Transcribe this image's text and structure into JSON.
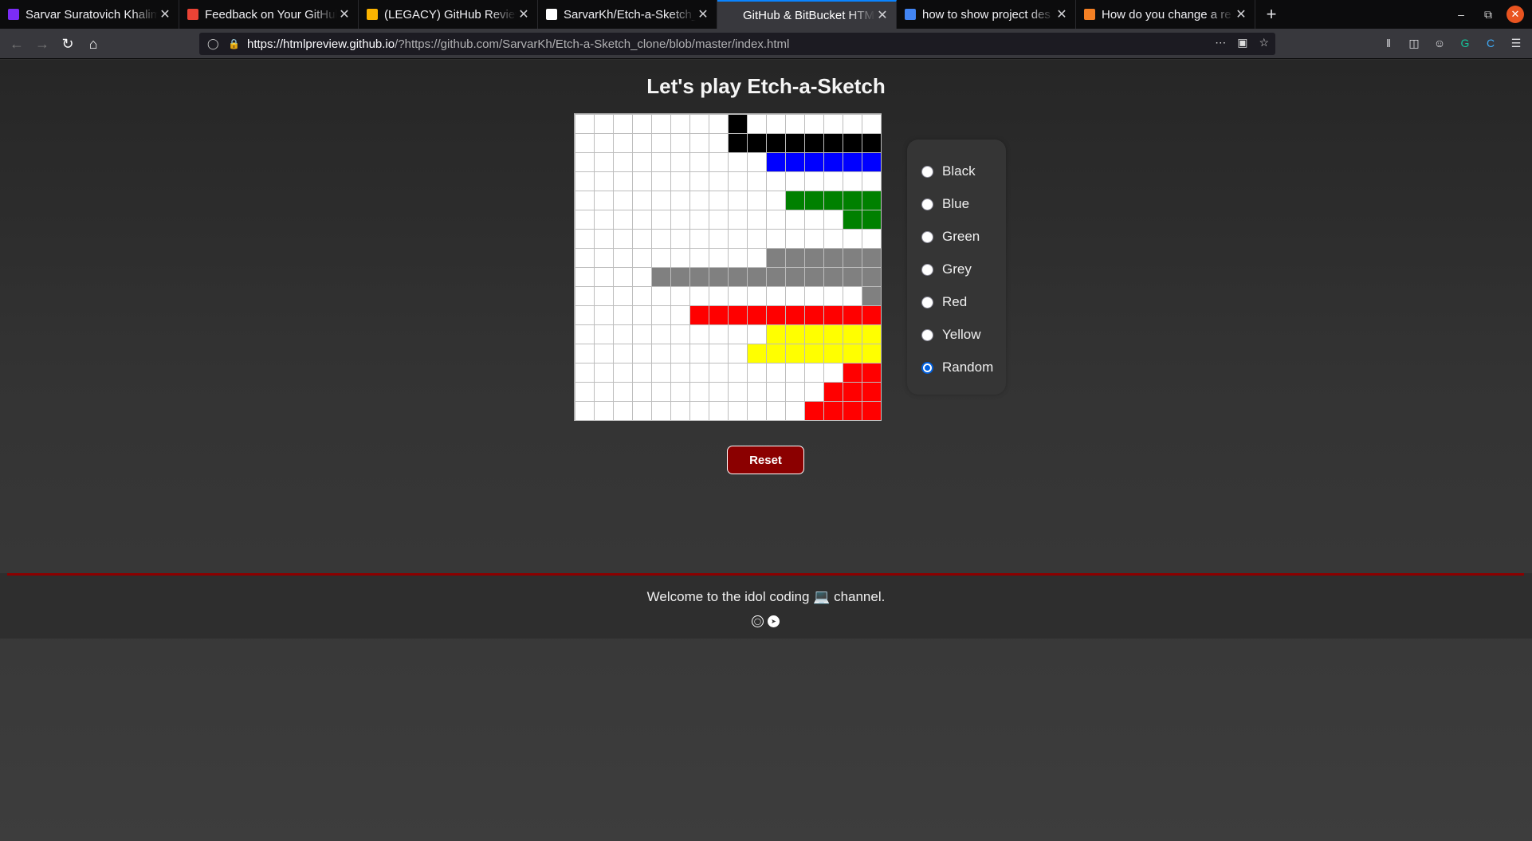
{
  "browser": {
    "tabs": [
      {
        "title": "Sarvar Suratovich Khalim",
        "active": false,
        "favicon": "profile-icon",
        "color": "#7b2cf5"
      },
      {
        "title": "Feedback on Your GitHub",
        "active": false,
        "favicon": "gmail-icon",
        "color": "#ea4335"
      },
      {
        "title": "(LEGACY) GitHub Review",
        "active": false,
        "favicon": "airtable-icon",
        "color": "#fcb400"
      },
      {
        "title": "SarvarKh/Etch-a-Sketch_",
        "active": false,
        "favicon": "github-icon",
        "color": "#ffffff"
      },
      {
        "title": "GitHub & BitBucket HTML P",
        "active": true,
        "favicon": "blank-icon",
        "color": "#38383d"
      },
      {
        "title": "how to show project des",
        "active": false,
        "favicon": "google-icon",
        "color": "#4285f4"
      },
      {
        "title": "How do you change a re",
        "active": false,
        "favicon": "stackoverflow-icon",
        "color": "#f48024"
      }
    ],
    "url_host": "https://htmlpreview.github.io",
    "url_rest": "/?https://github.com/SarvarKh/Etch-a-Sketch_clone/blob/master/index.html"
  },
  "page": {
    "title": "Let's play Etch-a-Sketch",
    "reset_label": "Reset",
    "options": [
      {
        "label": "Black",
        "checked": false
      },
      {
        "label": "Blue",
        "checked": false
      },
      {
        "label": "Green",
        "checked": false
      },
      {
        "label": "Grey",
        "checked": false
      },
      {
        "label": "Red",
        "checked": false
      },
      {
        "label": "Yellow",
        "checked": false
      },
      {
        "label": "Random",
        "checked": true
      }
    ],
    "grid_size": 16,
    "palette": {
      "k": "#000000",
      "b": "#0000ff",
      "g": "#008000",
      "y": "#808080",
      "r": "#ff0000",
      "Y": "#ffff00"
    },
    "grid_rows": [
      "........k.......",
      "........kkkkkkkk",
      "..........bbbbbb",
      "................",
      "...........ggggg",
      "..............gg",
      "................",
      "..........yyyyyy",
      "....yyyyyyyyyyyy",
      "...............y",
      "......rrrrrrrrrr",
      "..........YYYYYY",
      ".........YYYYYYY",
      "..............rr",
      ".............rrr",
      "............rrrr"
    ],
    "footer_text": "Welcome to the idol coding 💻 channel.",
    "social": [
      "instagram-icon",
      "telegram-icon"
    ]
  }
}
